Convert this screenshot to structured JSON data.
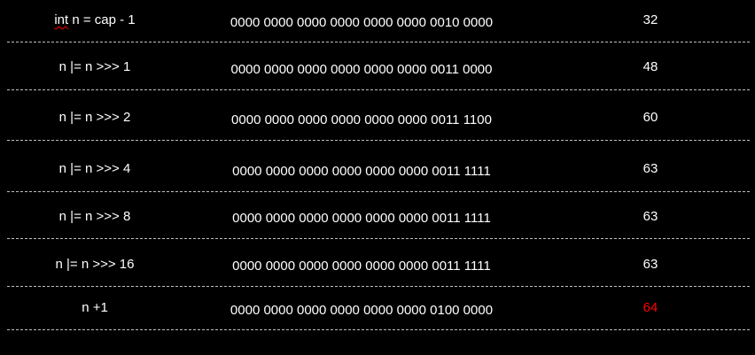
{
  "rows": [
    {
      "expr_keyword": "int",
      "expr": " n = cap - 1",
      "bits": "0000 0000 0000 0000 0000 0000 0010 0000",
      "value": "32"
    },
    {
      "expr": "n |= n >>> 1",
      "bits": "0000 0000 0000 0000 0000 0000 0011 0000",
      "value": "48"
    },
    {
      "expr": "n |= n >>> 2",
      "bits": "0000 0000 0000 0000 0000 0000 0011 1100",
      "value": "60"
    },
    {
      "expr": "n |= n >>> 4",
      "bits": "0000 0000 0000 0000 0000 0000 0011 1111",
      "value": "63"
    },
    {
      "expr": "n |= n >>> 8",
      "bits": "0000 0000 0000 0000 0000 0000 0011 1111",
      "value": "63"
    },
    {
      "expr": "n |= n >>> 16",
      "bits": "0000 0000 0000 0000 0000 0000 0011 1111",
      "value": "63"
    },
    {
      "expr": "n +1",
      "bits": "0000 0000 0000 0000 0000 0000 0100 0000",
      "value": "64"
    }
  ],
  "colors": {
    "background": "#000000",
    "text": "#ffffff",
    "highlight_value": "#ff0000",
    "divider": "#bfbfbf",
    "spellcheck_underline": "#ff0000"
  }
}
